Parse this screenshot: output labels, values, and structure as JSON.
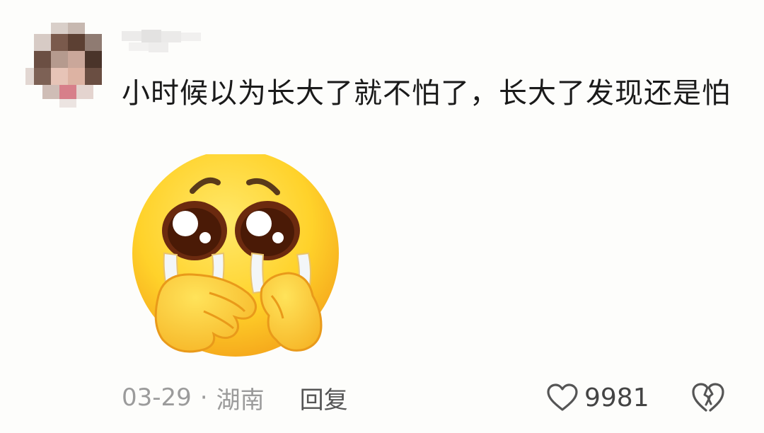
{
  "comment": {
    "text": "小时候以为长大了就不怕了，长大了发现还是怕",
    "date": "03-29",
    "separator": "·",
    "location": "湖南",
    "reply_label": "回复",
    "like_count": "9981"
  },
  "icons": {
    "avatar": "blurred-avatar",
    "username": "blurred-username",
    "sticker": "crying-covering-mouth-emoji-icon",
    "like": "heart-outline-icon",
    "dislike": "broken-heart-icon"
  },
  "colors": {
    "background": "#fdfdfb",
    "text": "#1a1a1a",
    "meta": "#9b9b9b",
    "reply": "#555555",
    "emoji_yellow": "#ffd22a",
    "emoji_orange": "#f4a31a"
  }
}
